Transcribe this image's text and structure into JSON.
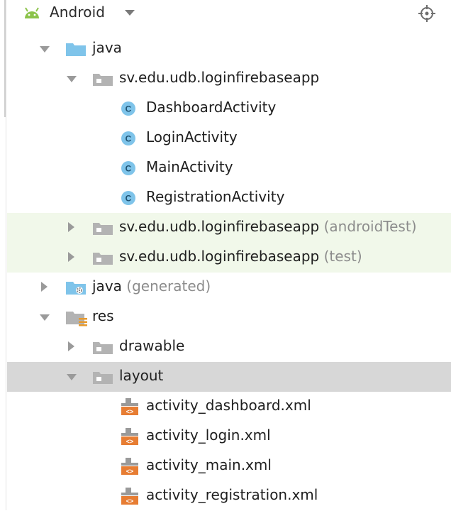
{
  "header": {
    "title": "Android",
    "view_icon": "android-icon",
    "action_icon": "locate-crosshair-icon"
  },
  "tree": {
    "java": {
      "label": "java"
    },
    "main_package": {
      "label": "sv.edu.udb.loginfirebaseapp",
      "classes": [
        "DashboardActivity",
        "LoginActivity",
        "MainActivity",
        "RegistrationActivity"
      ]
    },
    "android_test_package": {
      "label": "sv.edu.udb.loginfirebaseapp",
      "suffix": "(androidTest)"
    },
    "test_package": {
      "label": "sv.edu.udb.loginfirebaseapp",
      "suffix": "(test)"
    },
    "java_generated": {
      "label": "java",
      "suffix": "(generated)"
    },
    "res": {
      "label": "res"
    },
    "drawable": {
      "label": "drawable"
    },
    "layout": {
      "label": "layout",
      "files": [
        "activity_dashboard.xml",
        "activity_login.xml",
        "activity_main.xml",
        "activity_registration.xml"
      ]
    }
  },
  "colors": {
    "folder_blue": "#7fc4ea",
    "package_gray": "#b3b3b3",
    "class_badge": "#7fc4ea",
    "xml_orange": "#e77d33",
    "android_green": "#8bc34a",
    "highlight_green": "#f1f8ea",
    "selected_gray": "#d7d7d7"
  }
}
